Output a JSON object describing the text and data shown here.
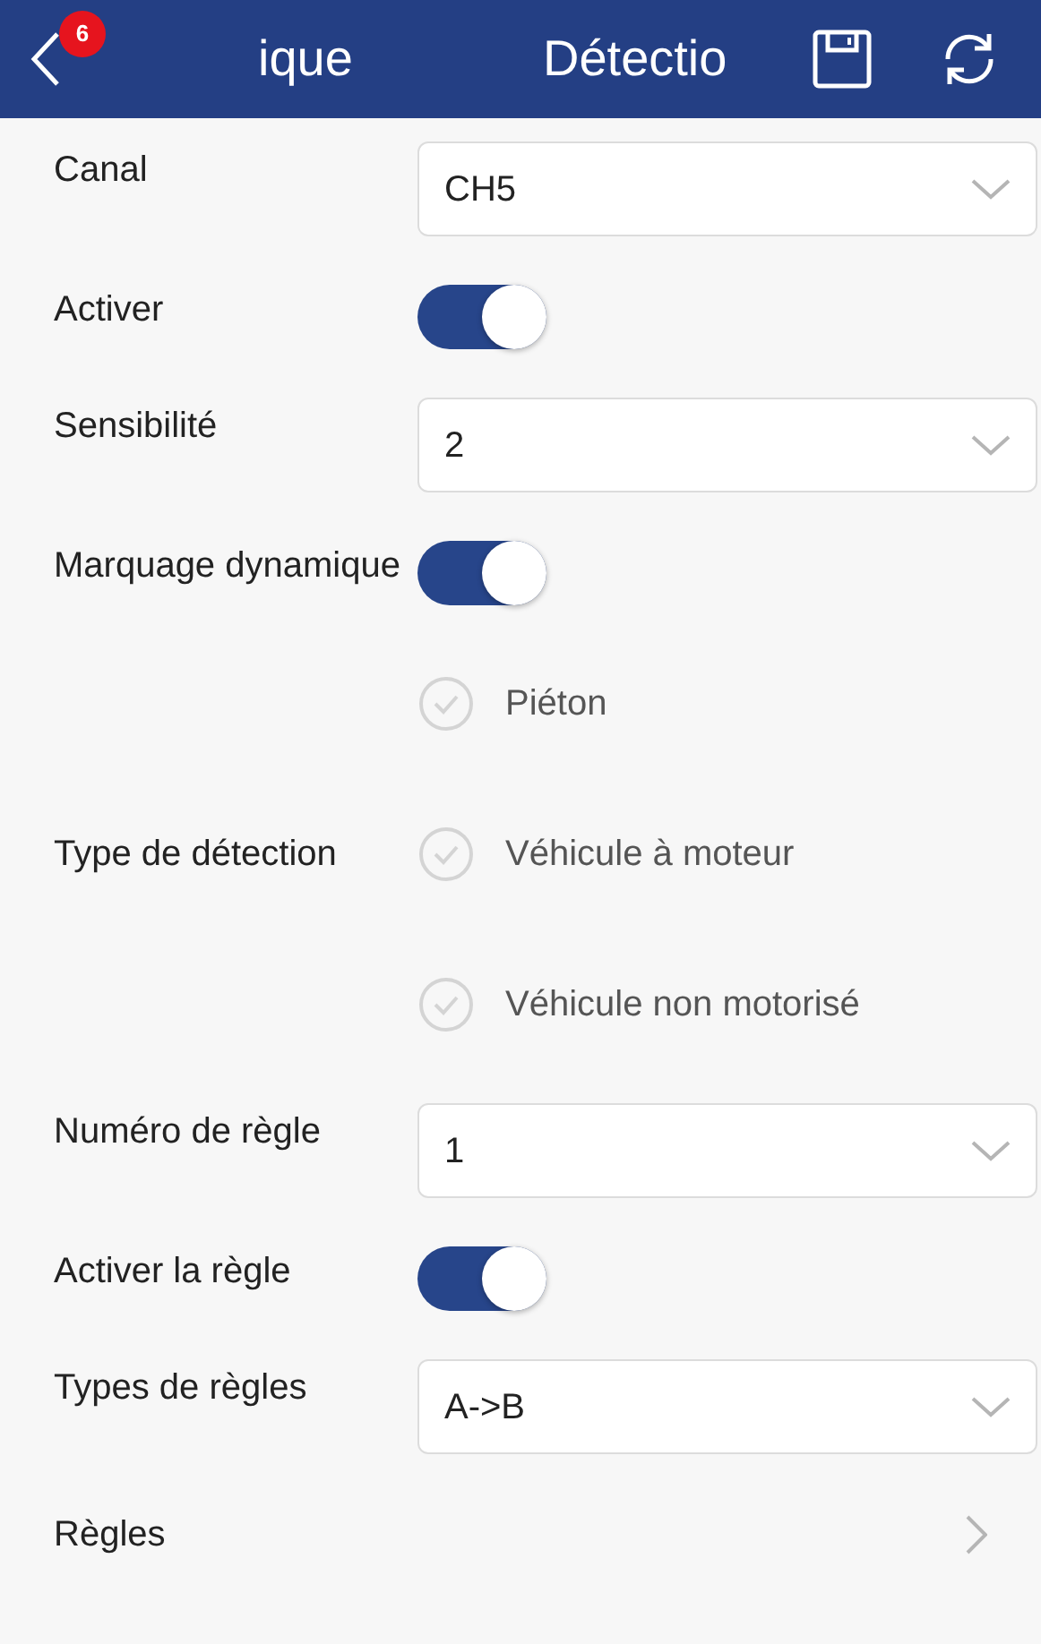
{
  "header": {
    "badge": "6",
    "tabs": [
      "ique",
      "Détectio"
    ]
  },
  "rows": [
    {
      "kind": "select",
      "label": "Canal",
      "value": "CH5"
    },
    {
      "kind": "toggle",
      "label": "Activer",
      "on": true
    },
    {
      "kind": "select",
      "label": "Sensibilité",
      "value": "2"
    },
    {
      "kind": "toggle",
      "label": "Marquage dynamique",
      "on": true
    },
    {
      "kind": "checks",
      "label": "Type de détection",
      "options": [
        {
          "label": "Piéton",
          "checked": false
        },
        {
          "label": "Véhicule à moteur",
          "checked": false
        },
        {
          "label": "Véhicule non motorisé",
          "checked": false
        }
      ]
    },
    {
      "kind": "select",
      "label": "Numéro de règle",
      "value": "1"
    },
    {
      "kind": "toggle",
      "label": "Activer la règle",
      "on": true
    },
    {
      "kind": "select",
      "label": "Types de règles",
      "value": "A->B"
    },
    {
      "kind": "link",
      "label": "Règles"
    }
  ]
}
